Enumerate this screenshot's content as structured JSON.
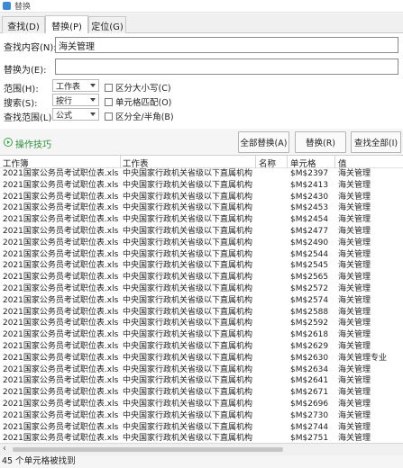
{
  "window": {
    "title": "替换"
  },
  "tabs": [
    {
      "label": "查找(D)"
    },
    {
      "label": "替换(P)"
    },
    {
      "label": "定位(G)"
    }
  ],
  "form": {
    "find_label": "查找内容(N):",
    "find_value": "海关管理",
    "replace_label": "替换为(E):",
    "replace_value": "",
    "scope_label": "范围(H):",
    "scope_value": "工作表",
    "search_label": "搜索(S):",
    "search_value": "按行",
    "lookin_label": "查找范围(L):",
    "lookin_value": "公式",
    "match_case": "区分大小写(C)",
    "match_cell": "单元格匹配(O)",
    "match_width": "区分全/半角(B)"
  },
  "actions": {
    "tips": "操作技巧",
    "replace_all": "全部替换(A)",
    "replace": "替换(R)",
    "find_all": "查找全部(I)"
  },
  "columns": [
    "工作簿",
    "工作表",
    "名称",
    "单元格",
    "值"
  ],
  "rows": [
    [
      "2021国家公务员考试职位表.xls",
      "中央国家行政机关省级以下直属机构",
      "",
      "$M$2397",
      "海关管理"
    ],
    [
      "2021国家公务员考试职位表.xls",
      "中央国家行政机关省级以下直属机构",
      "",
      "$M$2413",
      "海关管理"
    ],
    [
      "2021国家公务员考试职位表.xls",
      "中央国家行政机关省级以下直属机构",
      "",
      "$M$2430",
      "海关管理"
    ],
    [
      "2021国家公务员考试职位表.xls",
      "中央国家行政机关省级以下直属机构",
      "",
      "$M$2453",
      "海关管理"
    ],
    [
      "2021国家公务员考试职位表.xls",
      "中央国家行政机关省级以下直属机构",
      "",
      "$M$2454",
      "海关管理"
    ],
    [
      "2021国家公务员考试职位表.xls",
      "中央国家行政机关省级以下直属机构",
      "",
      "$M$2477",
      "海关管理"
    ],
    [
      "2021国家公务员考试职位表.xls",
      "中央国家行政机关省级以下直属机构",
      "",
      "$M$2490",
      "海关管理"
    ],
    [
      "2021国家公务员考试职位表.xls",
      "中央国家行政机关省级以下直属机构",
      "",
      "$M$2544",
      "海关管理"
    ],
    [
      "2021国家公务员考试职位表.xls",
      "中央国家行政机关省级以下直属机构",
      "",
      "$M$2545",
      "海关管理"
    ],
    [
      "2021国家公务员考试职位表.xls",
      "中央国家行政机关省级以下直属机构",
      "",
      "$M$2565",
      "海关管理"
    ],
    [
      "2021国家公务员考试职位表.xls",
      "中央国家行政机关省级以下直属机构",
      "",
      "$M$2572",
      "海关管理"
    ],
    [
      "2021国家公务员考试职位表.xls",
      "中央国家行政机关省级以下直属机构",
      "",
      "$M$2574",
      "海关管理"
    ],
    [
      "2021国家公务员考试职位表.xls",
      "中央国家行政机关省级以下直属机构",
      "",
      "$M$2588",
      "海关管理"
    ],
    [
      "2021国家公务员考试职位表.xls",
      "中央国家行政机关省级以下直属机构",
      "",
      "$M$2592",
      "海关管理"
    ],
    [
      "2021国家公务员考试职位表.xls",
      "中央国家行政机关省级以下直属机构",
      "",
      "$M$2618",
      "海关管理"
    ],
    [
      "2021国家公务员考试职位表.xls",
      "中央国家行政机关省级以下直属机构",
      "",
      "$M$2629",
      "海关管理"
    ],
    [
      "2021国家公务员考试职位表.xls",
      "中央国家行政机关省级以下直属机构",
      "",
      "$M$2630",
      "海关管理专业"
    ],
    [
      "2021国家公务员考试职位表.xls",
      "中央国家行政机关省级以下直属机构",
      "",
      "$M$2634",
      "海关管理"
    ],
    [
      "2021国家公务员考试职位表.xls",
      "中央国家行政机关省级以下直属机构",
      "",
      "$M$2641",
      "海关管理"
    ],
    [
      "2021国家公务员考试职位表.xls",
      "中央国家行政机关省级以下直属机构",
      "",
      "$M$2671",
      "海关管理"
    ],
    [
      "2021国家公务员考试职位表.xls",
      "中央国家行政机关省级以下直属机构",
      "",
      "$M$2696",
      "海关管理"
    ],
    [
      "2021国家公务员考试职位表.xls",
      "中央国家行政机关省级以下直属机构",
      "",
      "$M$2730",
      "海关管理"
    ],
    [
      "2021国家公务员考试职位表.xls",
      "中央国家行政机关省级以下直属机构",
      "",
      "$M$2744",
      "海关管理"
    ],
    [
      "2021国家公务员考试职位表.xls",
      "中央国家行政机关省级以下直属机构",
      "",
      "$M$2751",
      "海关管理"
    ]
  ],
  "status": "45 个单元格被找到"
}
